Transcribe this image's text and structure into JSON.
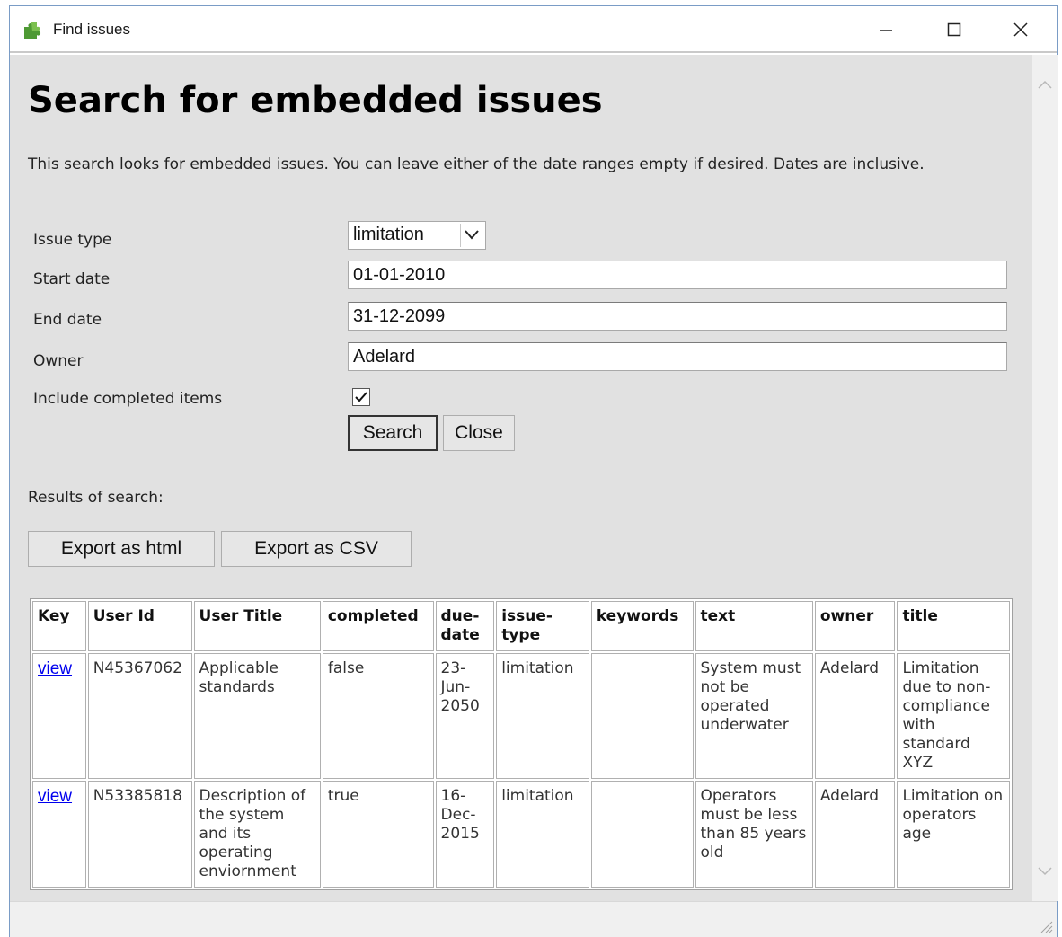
{
  "window": {
    "title": "Find issues"
  },
  "page": {
    "heading": "Search for embedded issues",
    "description": "This search looks for embedded issues. You can leave either of the date ranges empty if desired. Dates are inclusive."
  },
  "form": {
    "issue_type_label": "Issue type",
    "issue_type_value": "limitation",
    "start_date_label": "Start date",
    "start_date_value": "01-01-2010",
    "end_date_label": "End date",
    "end_date_value": "31-12-2099",
    "owner_label": "Owner",
    "owner_value": "Adelard",
    "include_completed_label": "Include completed items",
    "include_completed_checked": true,
    "search_label": "Search",
    "close_label": "Close"
  },
  "results": {
    "label": "Results of search:",
    "export_html_label": "Export as html",
    "export_csv_label": "Export as CSV",
    "columns": [
      "Key",
      "User Id",
      "User Title",
      "completed",
      "due-date",
      "issue-type",
      "keywords",
      "text",
      "owner",
      "title"
    ],
    "rows": [
      {
        "key": "view",
        "user_id": "N45367062",
        "user_title": "Applicable standards",
        "completed": "false",
        "due_date": "23-Jun-2050",
        "issue_type": "limitation",
        "keywords": "",
        "text": "System must not be operated underwater",
        "owner": "Adelard",
        "title": "Limitation due to non-compliance with standard XYZ"
      },
      {
        "key": "view",
        "user_id": "N53385818",
        "user_title": "Description of the system and its operating enviornment",
        "completed": "true",
        "due_date": "16-Dec-2015",
        "issue_type": "limitation",
        "keywords": "",
        "text": "Operators must be less than 85 years old",
        "owner": "Adelard",
        "title": "Limitation on operators age"
      }
    ]
  }
}
